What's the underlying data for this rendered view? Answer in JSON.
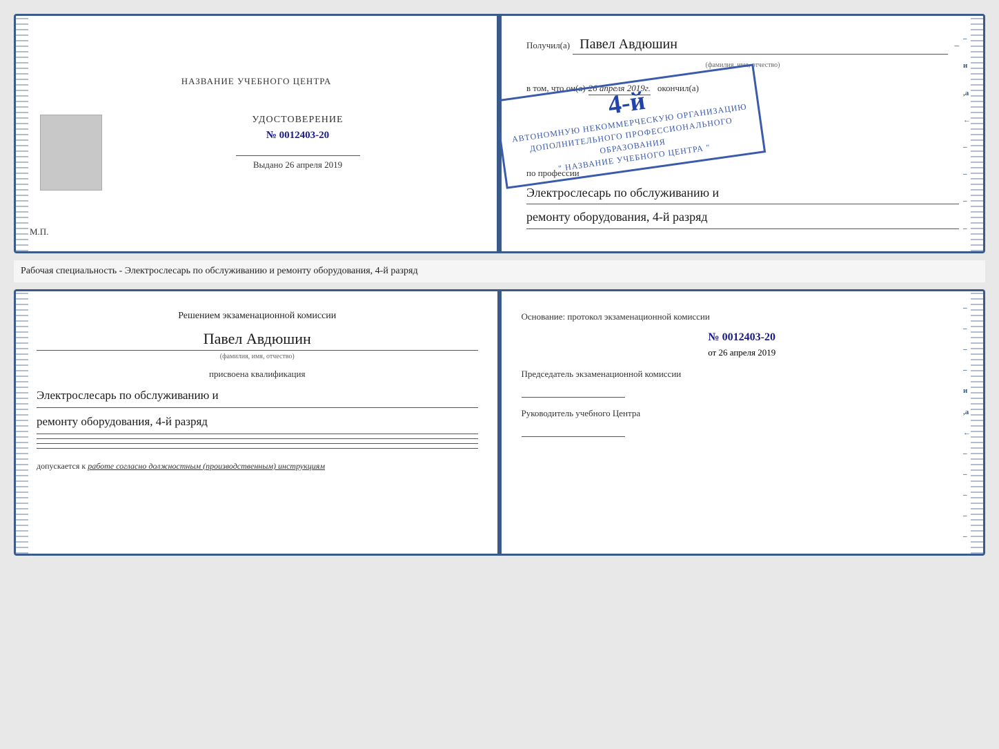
{
  "top_book": {
    "left_page": {
      "title": "НАЗВАНИЕ УЧЕБНОГО ЦЕНТРА",
      "udostoverenie": "УДОСТОВЕРЕНИЕ",
      "number": "№ 0012403-20",
      "vydano_label": "Выдано",
      "vydano_date": "26 апреля 2019",
      "mp": "М.П."
    },
    "right_page": {
      "poluchil_label": "Получил(а)",
      "name": "Павел Авдюшин",
      "fio_small": "(фамилия, имя, отчество)",
      "vtom_label": "в том, что он(а)",
      "date_italic": "26 апреля 2019г.",
      "okonchil_label": "окончил(а)",
      "stamp_line1": "АВТОНОМНУЮ НЕКОММЕРЧЕСКУЮ ОРГАНИЗАЦИЮ",
      "stamp_line2": "ДОПОЛНИТЕЛЬНОГО ПРОФЕССИОНАЛЬНОГО ОБРАЗОВАНИЯ",
      "stamp_line3": "\" НАЗВАНИЕ УЧЕБНОГО ЦЕНТРА \"",
      "stamp_grade": "4-й",
      "po_professii": "по профессии",
      "profession_line1": "Электрослесарь по обслуживанию и",
      "profession_line2": "ремонту оборудования, 4-й разряд"
    }
  },
  "middle": {
    "text": "Рабочая специальность - Электрослесарь по обслуживанию и ремонту оборудования, 4-й разряд"
  },
  "bottom_book": {
    "left_page": {
      "komissia_title": "Решением экзаменационной комиссии",
      "name": "Павел Авдюшин",
      "fio_small": "(фамилия, имя, отчество)",
      "kvali_label": "присвоена квалификация",
      "kvali_line1": "Электрослесарь по обслуживанию и",
      "kvali_line2": "ремонту оборудования, 4-й разряд",
      "sign_lines": [
        "",
        "",
        "",
        ""
      ],
      "dopuskaetsya": "допускается к",
      "dopuskaetsya_italic": "работе согласно должностным (производственным) инструкциям"
    },
    "right_page": {
      "osnovaniye": "Основание: протокол экзаменационной комиссии",
      "protocol_number": "№ 0012403-20",
      "ot_label": "от",
      "ot_date": "26 апреля 2019",
      "chairman_label": "Председатель экзаменационной комиссии",
      "rukovoditel_label": "Руководитель учебного Центра"
    }
  },
  "side_marks": {
    "marks": [
      "и",
      "а",
      "←",
      "–",
      "–",
      "–",
      "–",
      "–"
    ]
  }
}
